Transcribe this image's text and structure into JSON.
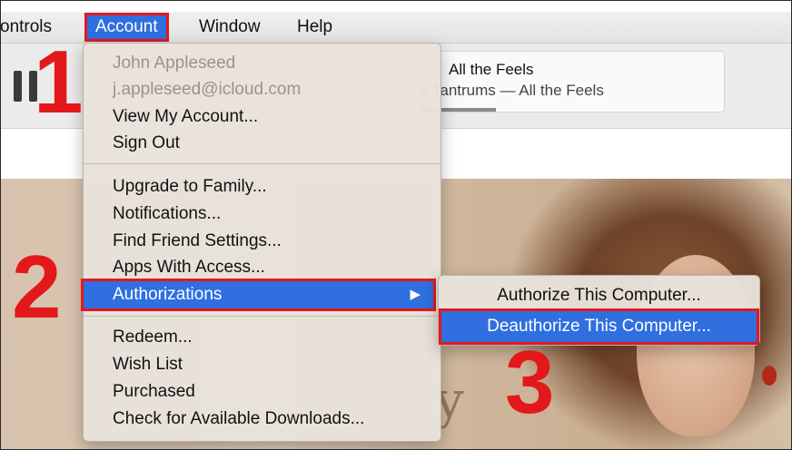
{
  "menubar": {
    "items": [
      "ontrols",
      "Account",
      "Window",
      "Help"
    ]
  },
  "now_playing": {
    "title": "All the Feels",
    "subtitle": "e Tantrums — All the Feels"
  },
  "account_menu": {
    "user_name": "John Appleseed",
    "user_email": "j.appleseed@icloud.com",
    "view_account": "View My Account...",
    "sign_out": "Sign Out",
    "upgrade": "Upgrade to Family...",
    "notifications": "Notifications...",
    "find_friend": "Find Friend Settings...",
    "apps_access": "Apps With Access...",
    "authorizations": "Authorizations",
    "redeem": "Redeem...",
    "wish_list": "Wish List",
    "purchased": "Purchased",
    "check_downloads": "Check for Available Downloads..."
  },
  "auth_submenu": {
    "authorize": "Authorize This Computer...",
    "deauthorize": "Deauthorize This Computer..."
  },
  "steps": [
    "1",
    "2",
    "3"
  ],
  "artwork_letter": "y",
  "colors": {
    "highlight": "#2f6fe0",
    "annotation_red": "#e3181b"
  },
  "icons": {
    "pause": "pause-icon",
    "submenu_arrow": "triangle-right-icon"
  },
  "glyphs": {
    "submenu_arrow": "▶"
  }
}
